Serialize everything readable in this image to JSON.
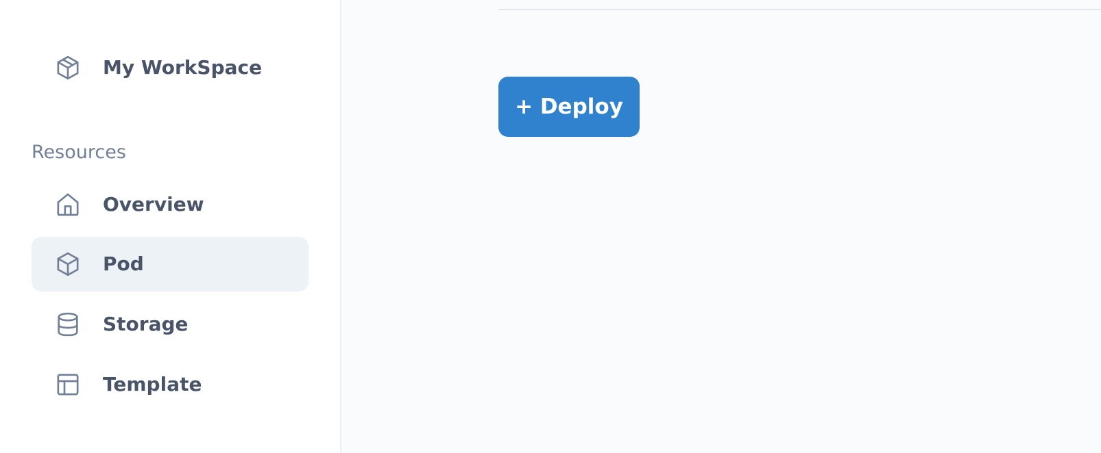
{
  "sidebar": {
    "workspace": {
      "label": "My WorkSpace",
      "icon": "package-icon"
    },
    "section_title": "Resources",
    "items": [
      {
        "label": "Overview",
        "icon": "home-icon",
        "active": false
      },
      {
        "label": "Pod",
        "icon": "cube-icon",
        "active": true
      },
      {
        "label": "Storage",
        "icon": "database-icon",
        "active": false
      },
      {
        "label": "Template",
        "icon": "layout-icon",
        "active": false
      }
    ]
  },
  "main": {
    "deploy_label": "+ Deploy"
  },
  "colors": {
    "accent": "#3182ce",
    "text": "#4a5468",
    "muted": "#718096",
    "icon": "#718096",
    "active_bg": "#edf2f7"
  }
}
